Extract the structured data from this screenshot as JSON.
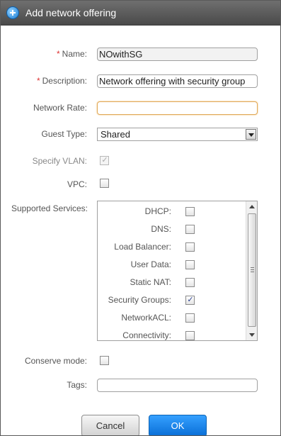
{
  "dialog": {
    "title": "Add network offering"
  },
  "form": {
    "name": {
      "label": "Name:",
      "required_mark": "*",
      "value": "NOwithSG"
    },
    "description": {
      "label": "Description:",
      "required_mark": "*",
      "value": "Network offering with security group"
    },
    "network_rate": {
      "label": "Network Rate:",
      "value": ""
    },
    "guest_type": {
      "label": "Guest Type:",
      "selected": "Shared"
    },
    "specify_vlan": {
      "label": "Specify VLAN:",
      "checked": true,
      "disabled": true
    },
    "vpc": {
      "label": "VPC:",
      "checked": false
    },
    "supported_services": {
      "label": "Supported Services:",
      "items": [
        {
          "label": "DHCP:",
          "checked": false
        },
        {
          "label": "DNS:",
          "checked": false
        },
        {
          "label": "Load Balancer:",
          "checked": false
        },
        {
          "label": "User Data:",
          "checked": false
        },
        {
          "label": "Static NAT:",
          "checked": false
        },
        {
          "label": "Security Groups:",
          "checked": true
        },
        {
          "label": "NetworkACL:",
          "checked": false
        },
        {
          "label": "Connectivity:",
          "checked": false
        }
      ]
    },
    "conserve_mode": {
      "label": "Conserve mode:",
      "checked": false
    },
    "tags": {
      "label": "Tags:",
      "value": ""
    }
  },
  "buttons": {
    "cancel": "Cancel",
    "ok": "OK"
  },
  "check_glyph": "✓"
}
